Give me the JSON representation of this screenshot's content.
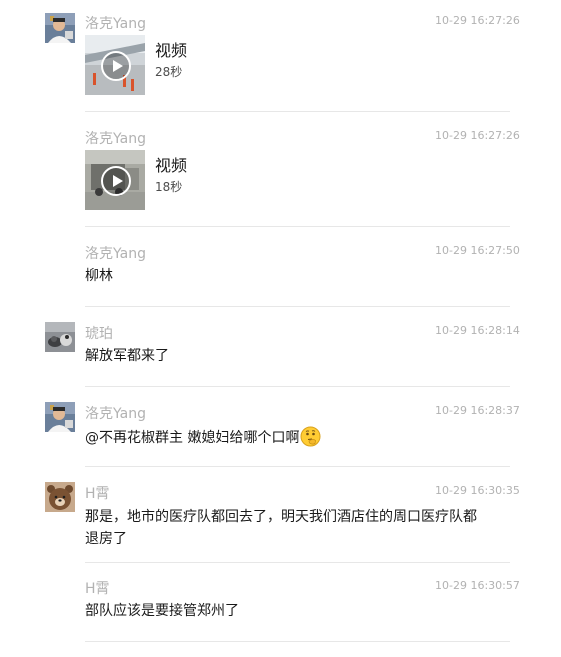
{
  "messages": [
    {
      "sender": "洛克Yang",
      "time": "10-29 16:27:26",
      "type": "video",
      "video_label": "视频",
      "duration": "28秒",
      "avatar": "man-avatar"
    },
    {
      "sender": "洛克Yang",
      "time": "10-29 16:27:26",
      "type": "video",
      "video_label": "视频",
      "duration": "18秒"
    },
    {
      "sender": "洛克Yang",
      "time": "10-29 16:27:50",
      "type": "text",
      "text": "柳林"
    },
    {
      "sender": "琥珀",
      "time": "10-29 16:28:14",
      "type": "text",
      "text": "解放军都来了",
      "avatar": "cat-avatar"
    },
    {
      "sender": "洛克Yang",
      "time": "10-29 16:28:37",
      "type": "text",
      "text": "@不再花椒群主 嫩媳妇给哪个口啊",
      "emoji": "thinking-face-icon",
      "avatar": "man-avatar"
    },
    {
      "sender": "H霄",
      "time": "10-29 16:30:35",
      "type": "text",
      "text": "那是，地市的医疗队都回去了，明天我们酒店住的周口医疗队都退房了",
      "avatar": "bear-avatar"
    },
    {
      "sender": "H霄",
      "time": "10-29 16:30:57",
      "type": "text",
      "text": "部队应该是要接管郑州了"
    }
  ],
  "colors": {
    "meta_text": "#b2b2b2",
    "body_text": "#1a1a1a",
    "divider": "#e7e7e7"
  }
}
